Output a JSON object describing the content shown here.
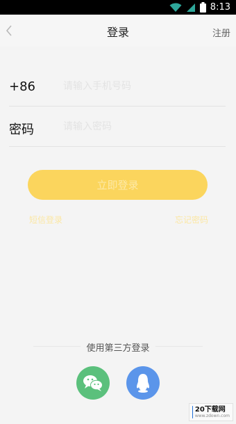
{
  "status_bar": {
    "time": "8:13"
  },
  "header": {
    "title": "登录",
    "register_label": "注册"
  },
  "form": {
    "phone": {
      "label": "+86",
      "placeholder": "请输入手机号码"
    },
    "password": {
      "label": "密码",
      "placeholder": "请输入密码"
    }
  },
  "login_button": {
    "label": "立即登录"
  },
  "links": {
    "left": "短信登录",
    "right": "忘记密码"
  },
  "third_party": {
    "label": "使用第三方登录",
    "wechat_icon": "wechat-icon",
    "qq_icon": "qq-icon"
  },
  "watermark": {
    "text": "20下载网",
    "sub": "www.zdown.com"
  },
  "colors": {
    "accent": "#fbd55d",
    "wechat": "#5bc07c",
    "qq": "#5b95ea"
  }
}
